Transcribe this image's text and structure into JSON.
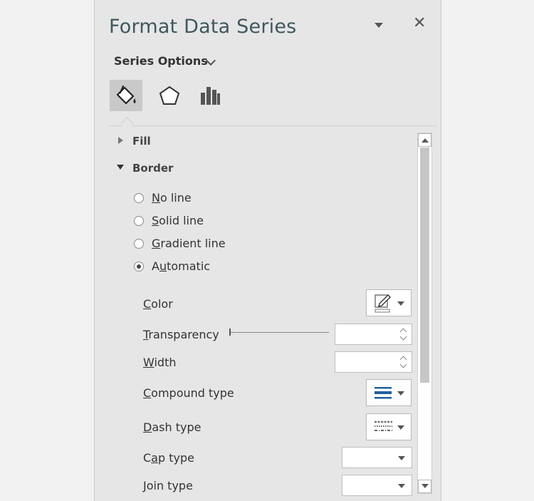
{
  "header": {
    "title": "Format Data Series",
    "dropdown_icon": "caret-down-icon",
    "close_icon": "close-icon",
    "close_glyph": "✕"
  },
  "series_options": {
    "label": "Series Options",
    "icon": "chevron-down-icon"
  },
  "tabs": [
    {
      "name": "Fill & Line",
      "icon": "paint-bucket-icon",
      "active": true
    },
    {
      "name": "Effects",
      "icon": "pentagon-icon",
      "active": false
    },
    {
      "name": "Series Options",
      "icon": "bar-chart-icon",
      "active": false
    }
  ],
  "sections": {
    "fill": "Fill",
    "border": "Border"
  },
  "border_options": [
    {
      "key": "N",
      "rest": "o line",
      "selected": false
    },
    {
      "key": "S",
      "rest": "olid line",
      "selected": false
    },
    {
      "key": "G",
      "rest": "radient line",
      "selected": false
    },
    {
      "pre": "A",
      "key": "u",
      "rest": "tomatic",
      "selected": true
    }
  ],
  "properties": {
    "color": {
      "key": "C",
      "rest": "olor"
    },
    "transparency": {
      "key": "T",
      "rest": "ransparency",
      "value": ""
    },
    "width": {
      "key": "W",
      "rest": "idth",
      "value": ""
    },
    "compound_type": {
      "key": "C",
      "rest": "ompound type"
    },
    "dash_type": {
      "key": "D",
      "rest": "ash type"
    },
    "cap_type": {
      "pre": "C",
      "key": "a",
      "rest": "p type",
      "value": ""
    },
    "join_type": {
      "key": "J",
      "rest": "oin type",
      "value": ""
    }
  },
  "colors": {
    "pane_bg": "#e6e6e6",
    "title": "#40575e",
    "active_tab": "#c9c9c9",
    "accent_blue": "#1f5f9e"
  }
}
